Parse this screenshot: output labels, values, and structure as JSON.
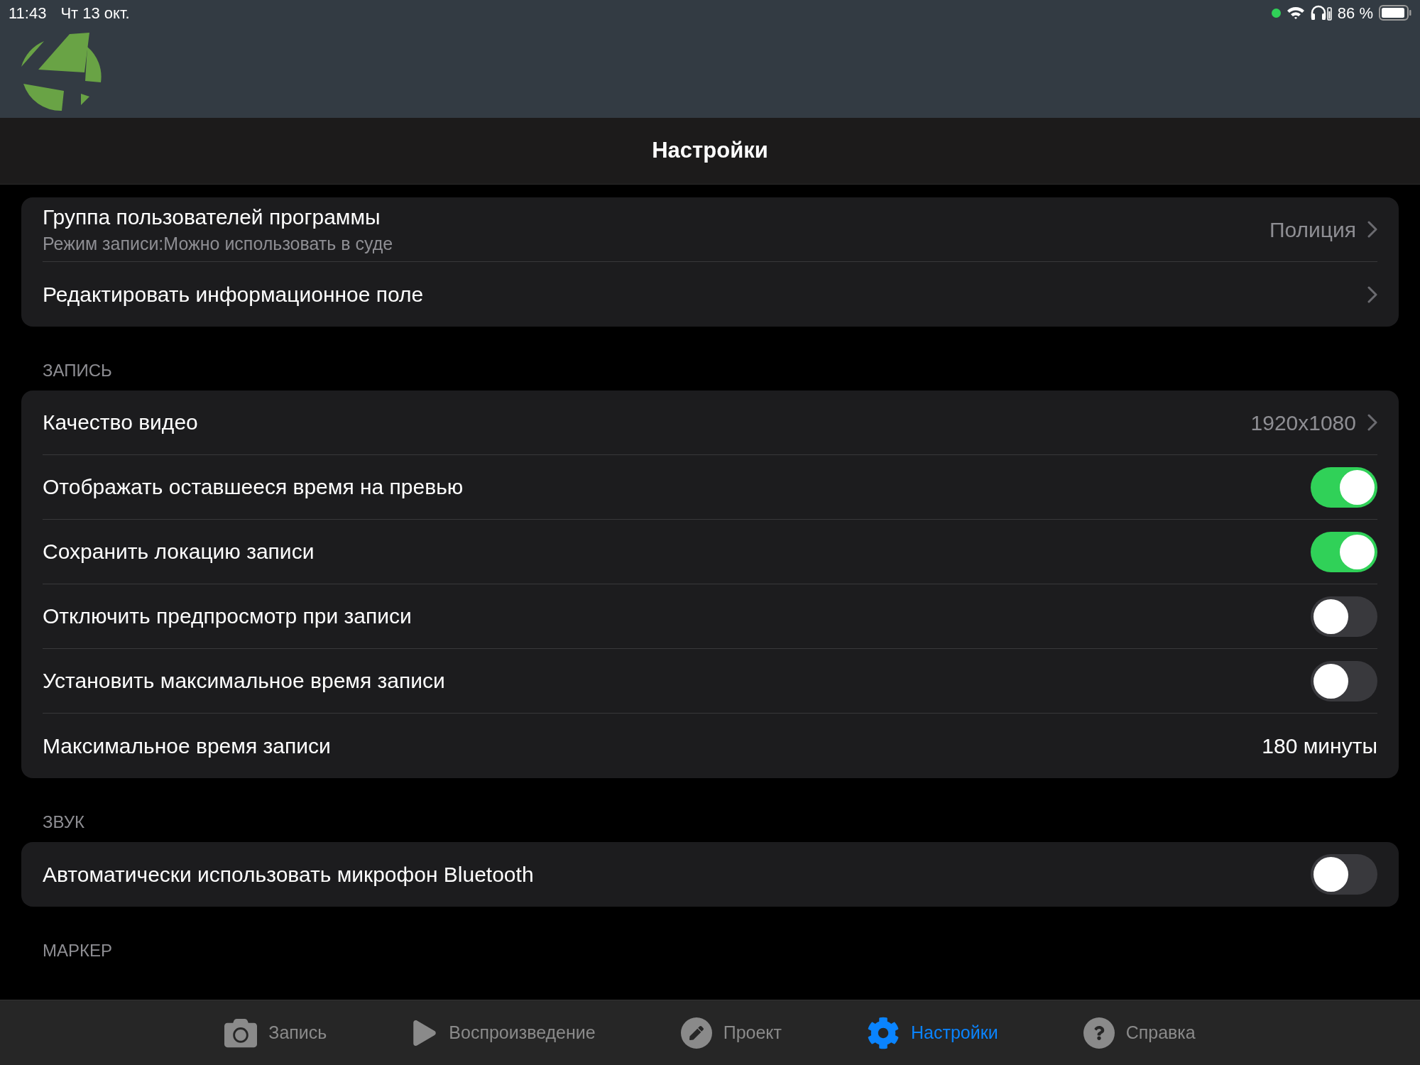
{
  "status_bar": {
    "time": "11:43",
    "date": "Чт 13 окт.",
    "battery": "86 %"
  },
  "nav": {
    "title": "Настройки"
  },
  "sections": [
    {
      "rows": [
        {
          "kind": "link",
          "title": "Группа пользователей программы",
          "subtitle": "Режим записи:Можно использовать в суде",
          "value": "Полиция"
        },
        {
          "kind": "link",
          "title": "Редактировать информационное поле"
        }
      ]
    },
    {
      "header": "ЗАПИСЬ",
      "rows": [
        {
          "kind": "link",
          "title": "Качество видео",
          "value": "1920x1080"
        },
        {
          "kind": "toggle",
          "title": "Отображать оставшееся время на превью",
          "on": true
        },
        {
          "kind": "toggle",
          "title": "Сохранить локацию записи",
          "on": true
        },
        {
          "kind": "toggle",
          "title": "Отключить предпросмотр при записи",
          "on": false
        },
        {
          "kind": "toggle",
          "title": "Установить максимальное время записи",
          "on": false
        },
        {
          "kind": "value",
          "title": "Максимальное время записи",
          "value": "180 минуты"
        }
      ]
    },
    {
      "header": "ЗВУК",
      "rows": [
        {
          "kind": "toggle",
          "title": "Автоматически использовать микрофон Bluetooth",
          "on": false
        }
      ]
    },
    {
      "header": "МАРКЕР"
    }
  ],
  "tabs": [
    {
      "kind": "camera",
      "label": "Запись",
      "selected": false
    },
    {
      "kind": "play",
      "label": "Воспроизведение",
      "selected": false
    },
    {
      "kind": "pencil",
      "label": "Проект",
      "selected": false
    },
    {
      "kind": "gear",
      "label": "Настройки",
      "selected": true
    },
    {
      "kind": "help",
      "label": "Справка",
      "selected": false
    }
  ]
}
